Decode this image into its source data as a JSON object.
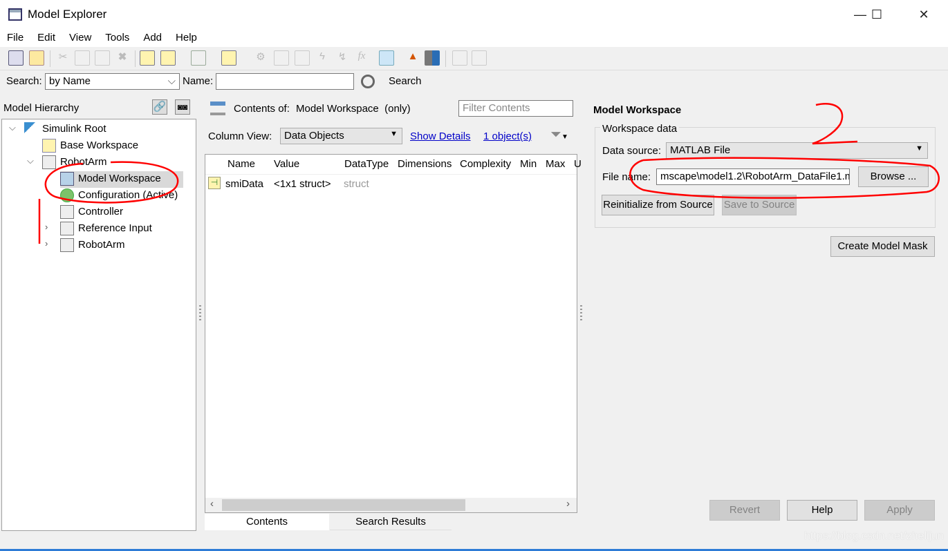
{
  "window": {
    "title": "Model Explorer",
    "controls": [
      "—",
      "☐",
      "✕"
    ]
  },
  "menu": [
    "File",
    "Edit",
    "View",
    "Tools",
    "Add",
    "Help"
  ],
  "search": {
    "label": "Search:",
    "mode": "by Name",
    "name_label": "Name:",
    "name_value": "",
    "button": "Search"
  },
  "hierarchy": {
    "title": "Model Hierarchy",
    "items": [
      {
        "label": "Simulink Root",
        "expanded": true
      },
      {
        "label": "Base Workspace"
      },
      {
        "label": "RobotArm",
        "expanded": true
      },
      {
        "label": "Model Workspace",
        "selected": true
      },
      {
        "label": "Configuration (Active)"
      },
      {
        "label": "Controller"
      },
      {
        "label": "Reference Input",
        "collapsed": true
      },
      {
        "label": "RobotArm",
        "collapsed": true
      }
    ]
  },
  "contents": {
    "header_label": "Contents of:",
    "header_value": "Model Workspace  (only)",
    "filter_placeholder": "Filter Contents",
    "column_view_label": "Column View:",
    "column_view": "Data Objects",
    "show_details": "Show Details",
    "object_count": "1 object(s)",
    "columns": [
      "Name",
      "Value",
      "DataType",
      "Dimensions",
      "Complexity",
      "Min",
      "Max",
      "U"
    ],
    "rows": [
      {
        "name": "smiData",
        "value": "<1x1 struct>",
        "datatype": "struct"
      }
    ],
    "tabs": [
      "Contents",
      "Search Results"
    ]
  },
  "workspace": {
    "title": "Model Workspace",
    "group": "Workspace data",
    "data_source_label": "Data source:",
    "data_source": "MATLAB File",
    "file_name_label": "File name:",
    "file_name": "mscape\\model1.2\\RobotArm_DataFile1.m",
    "browse": "Browse ...",
    "reinit": "Reinitialize from Source",
    "save": "Save to Source",
    "mask": "Create Model Mask",
    "revert": "Revert",
    "help": "Help",
    "apply": "Apply"
  },
  "watermark": "https://blog.csdn.net/zhelijun",
  "colors": {
    "annotation": "#ff0000",
    "link": "#0000c8",
    "selection": "#d9d9d9"
  }
}
